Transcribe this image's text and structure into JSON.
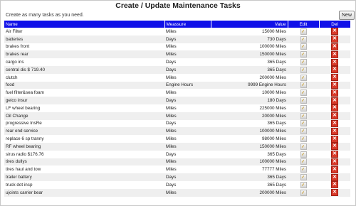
{
  "page": {
    "title": "Create / Update Maintenance Tasks",
    "hint": "Create as many tasks as you need.",
    "new_label": "New"
  },
  "table": {
    "headers": {
      "name": "Name",
      "measure": "Meassure",
      "value": "Value",
      "edit": "Edit",
      "del": "Del"
    },
    "rows": [
      {
        "name": "Air Filter",
        "measure": "Miles",
        "value": "15000 Miles"
      },
      {
        "name": "batteries",
        "measure": "Days",
        "value": "730 Days"
      },
      {
        "name": "brakes front",
        "measure": "Miles",
        "value": "100000 Miles"
      },
      {
        "name": "brakes rear",
        "measure": "Miles",
        "value": "150000 Miles"
      },
      {
        "name": "cargo ins",
        "measure": "Days",
        "value": "365 Days"
      },
      {
        "name": "central dis $ 719.40",
        "measure": "Days",
        "value": "365 Days"
      },
      {
        "name": "clutch",
        "measure": "Miles",
        "value": "200000 Miles"
      },
      {
        "name": "food",
        "measure": "Engine Hours",
        "value": "9999 Engine Hours"
      },
      {
        "name": "fuel filter&sea foam",
        "measure": "Miles",
        "value": "10000 Miles"
      },
      {
        "name": "geico insur",
        "measure": "Days",
        "value": "180 Days"
      },
      {
        "name": "LF wheel bearing",
        "measure": "Miles",
        "value": "225000 Miles"
      },
      {
        "name": "Oil Change",
        "measure": "Miles",
        "value": "20000 Miles"
      },
      {
        "name": "progressive InsRe",
        "measure": "Days",
        "value": "365 Days"
      },
      {
        "name": "rear end service",
        "measure": "Miles",
        "value": "100000 Miles"
      },
      {
        "name": "replace 6 sp tranny",
        "measure": "Miles",
        "value": "98000 Miles"
      },
      {
        "name": "RF wheel bearing",
        "measure": "Miles",
        "value": "150000 Miles"
      },
      {
        "name": "sirus radio $176.76",
        "measure": "Days",
        "value": "365 Days"
      },
      {
        "name": "tires dullys",
        "measure": "Miles",
        "value": "100000 Miles"
      },
      {
        "name": "tires haul and tow",
        "measure": "Miles",
        "value": "77777 Miles"
      },
      {
        "name": "trailer battery",
        "measure": "Days",
        "value": "365 Days"
      },
      {
        "name": "truck dot insp",
        "measure": "Days",
        "value": "365 Days"
      },
      {
        "name": "ujoints carrier bear",
        "measure": "Miles",
        "value": "200000 Miles"
      }
    ]
  },
  "icons": {
    "edit": "edit-pencil-icon",
    "delete": "delete-x-icon"
  },
  "colors": {
    "header_bg": "#1010e8",
    "alt_row": "#efefef",
    "delete_red": "#d83a2a"
  }
}
